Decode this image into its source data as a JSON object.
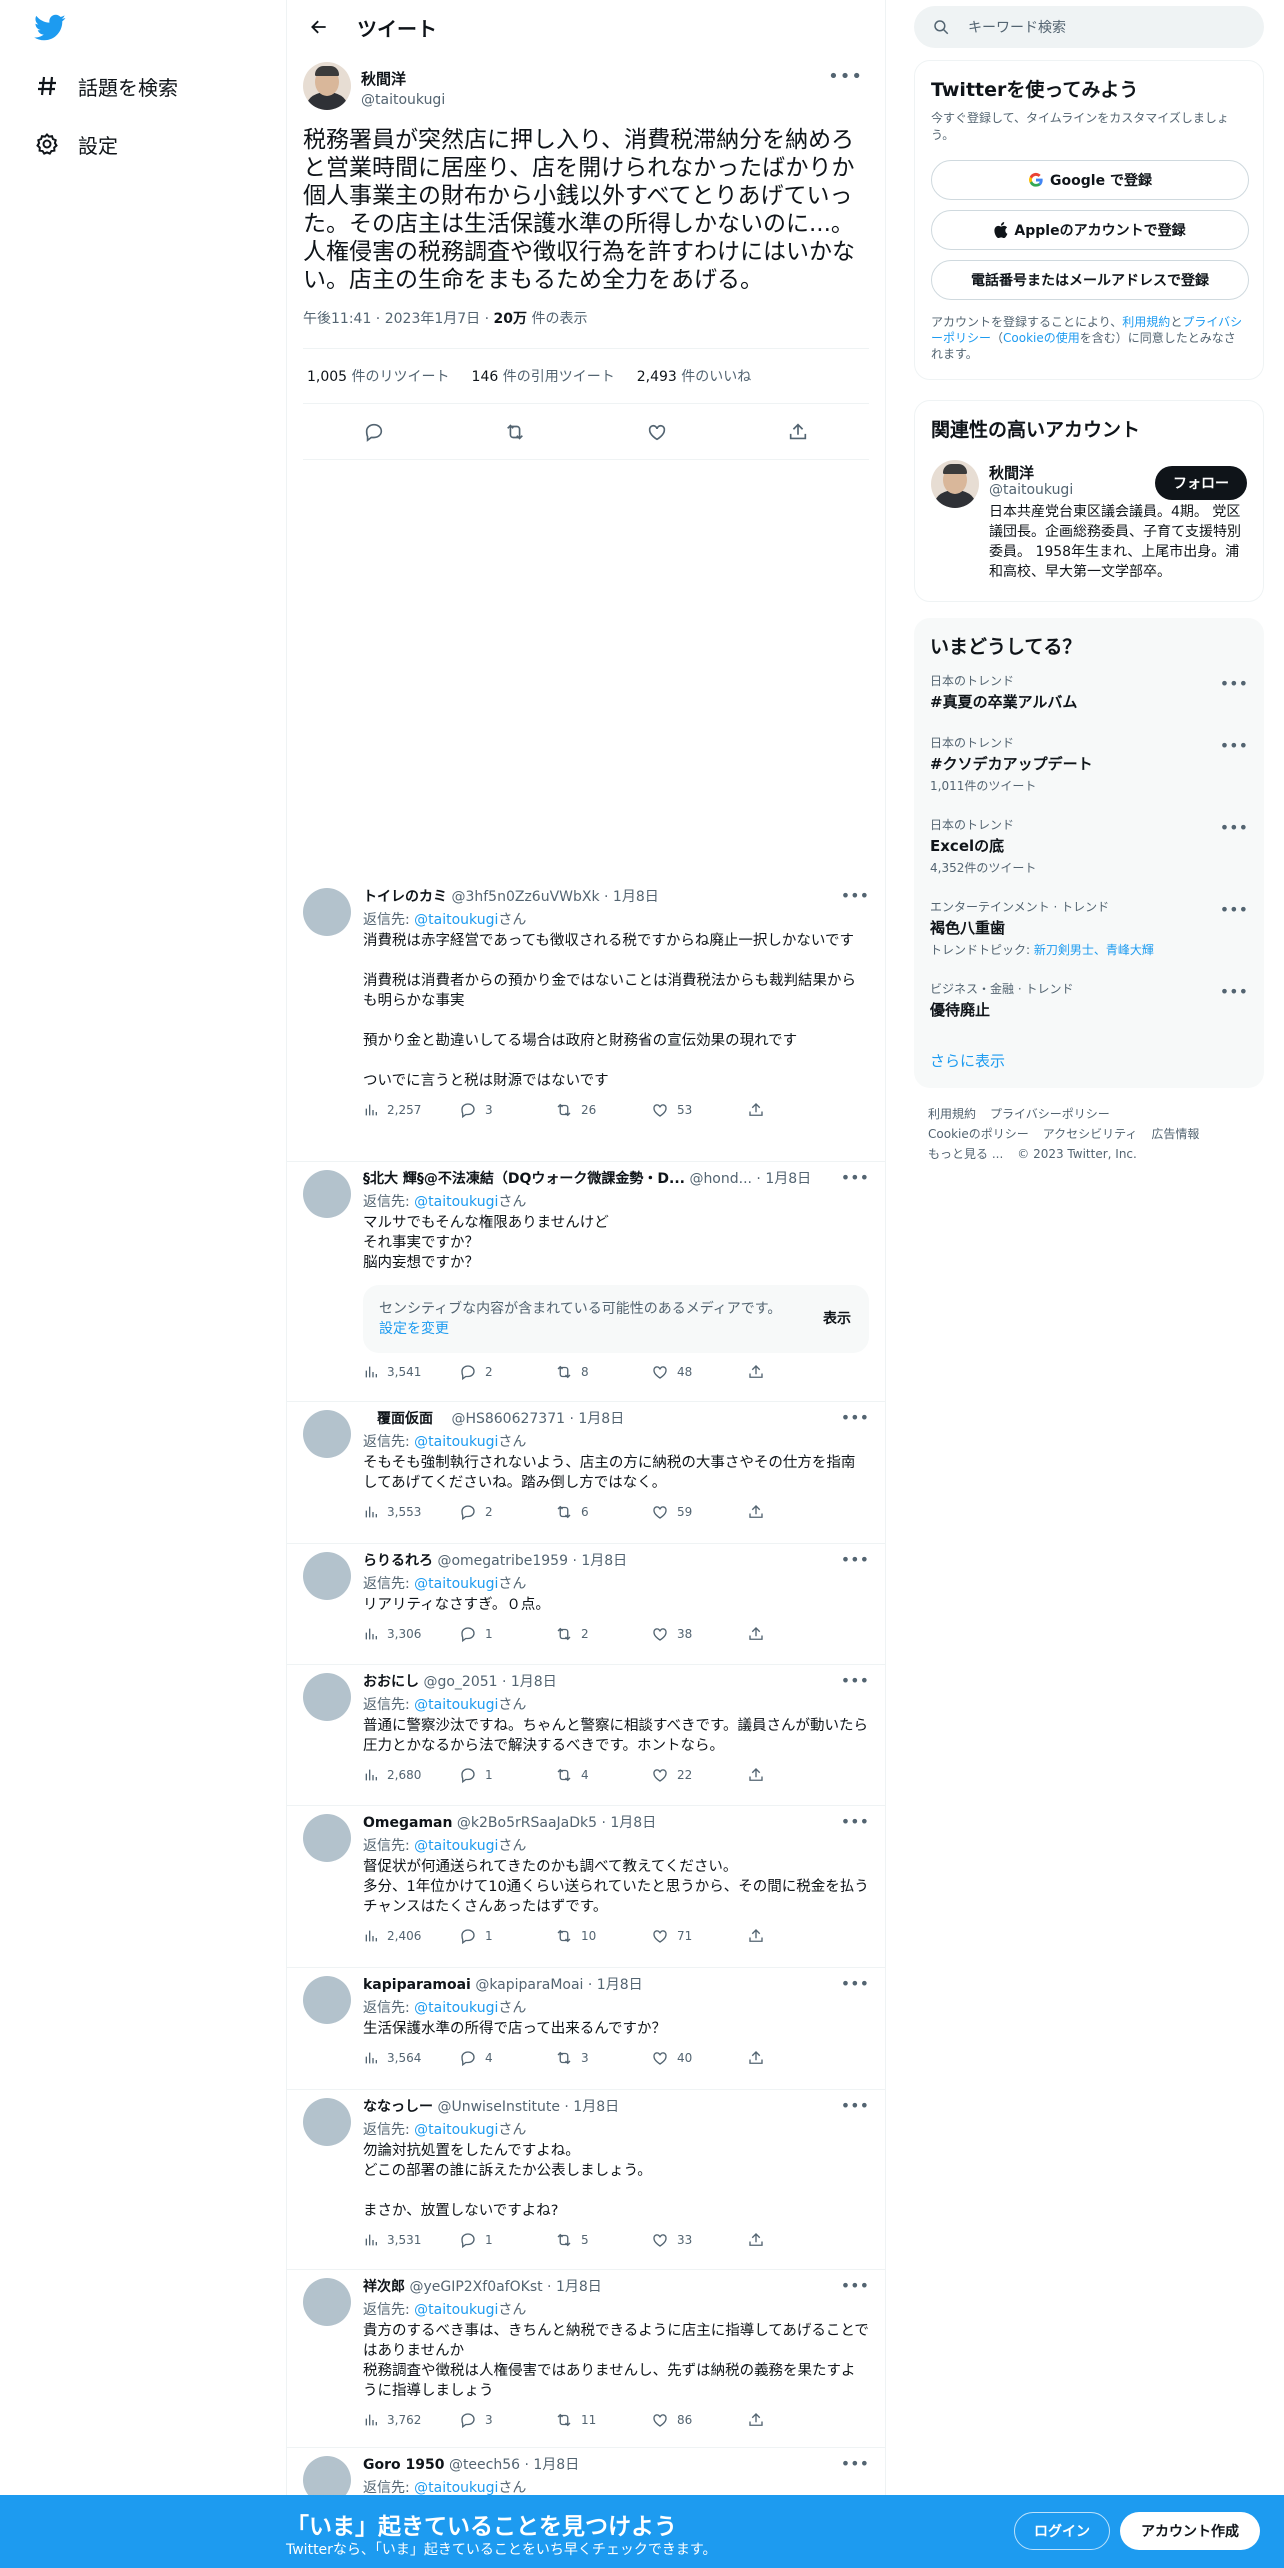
{
  "nav": {
    "explore": "話題を検索",
    "settings": "設定"
  },
  "header": {
    "title": "ツイート"
  },
  "main_tweet": {
    "name": "秋間洋",
    "handle": "@taitoukugi",
    "text": "税務署員が突然店に押し入り、消費税滞納分を納めろと営業時間に居座り、店を開けられなかったばかりか個人事業主の財布から小銭以外すべてとりあげていった。その店主は生活保護水準の所得しかないのに...。人権侵害の税務調査や徴収行為を許すわけにはいかない。店主の生命をまもるため全力をあげる。",
    "time": "午後11:41",
    "date": "2023年1月7日",
    "views": "20万",
    "views_label": "件の表示",
    "retweets": "1,005",
    "retweets_label": "件のリツイート",
    "quotes": "146",
    "quotes_label": "件の引用ツイート",
    "likes": "2,493",
    "likes_label": "件のいいね"
  },
  "reply_label": "返信先:",
  "reply_to": "@taitoukugi",
  "reply_suffix": "さん",
  "sensitive": {
    "text": "センシティブな内容が含まれている可能性のあるメディアです。",
    "link": "設定を変更",
    "show": "表示"
  },
  "replies": [
    {
      "name": "トイレのカミ",
      "meta": "@3hf5n0Zz6uVWbXk · 1月8日",
      "text": "消費税は赤字経営であっても徴収される税ですからね廃止一択しかないです\n\n消費税は消費者からの預かり金ではないことは消費税法からも裁判結果からも明らかな事実\n\n預かり金と勘違いしてる場合は政府と財務省の宣伝効果の現れです\n\nついでに言うと税は財源ではないです",
      "views": "2,257",
      "replies": "3",
      "retweets": "26",
      "likes": "53"
    },
    {
      "name": "§北大 輝§@不法凍結（DQウォーク微課金勢・D...",
      "meta": "@hond... · 1月8日",
      "text": "マルサでもそんな権限ありませんけど\nそれ事実ですか？\n脳内妄想ですか？",
      "views": "3,541",
      "replies": "2",
      "retweets": "8",
      "likes": "48"
    },
    {
      "name": "　覆面仮面　",
      "meta": "@HS860627371 · 1月8日",
      "text": "そもそも強制執行されないよう、店主の方に納税の大事さやその仕方を指南してあげてくださいね。踏み倒し方ではなく。",
      "views": "3,553",
      "replies": "2",
      "retweets": "6",
      "likes": "59"
    },
    {
      "name": "らりるれろ",
      "meta": "@omegatribe1959 · 1月8日",
      "text": "リアリティなさすぎ。０点。",
      "views": "3,306",
      "replies": "1",
      "retweets": "2",
      "likes": "38"
    },
    {
      "name": "おおにし",
      "meta": "@go_2051 · 1月8日",
      "text": "普通に警察沙汰ですね。ちゃんと警察に相談すべきです。議員さんが動いたら圧力とかなるから法で解決するべきです。ホントなら。",
      "views": "2,680",
      "replies": "1",
      "retweets": "4",
      "likes": "22"
    },
    {
      "name": "Omegaman",
      "meta": "@k2Bo5rRSaaJaDk5 · 1月8日",
      "text": "督促状が何通送られてきたのかも調べて教えてください。\n多分、1年位かけて10通くらい送られていたと思うから、その間に税金を払うチャンスはたくさんあったはずです。",
      "views": "2,406",
      "replies": "1",
      "retweets": "10",
      "likes": "71"
    },
    {
      "name": "kapiparamoai",
      "meta": "@kapiparaMoai · 1月8日",
      "text": "生活保護水準の所得で店って出来るんですか？",
      "views": "3,564",
      "replies": "4",
      "retweets": "3",
      "likes": "40"
    },
    {
      "name": "ななっしー",
      "meta": "@UnwiseInstitute · 1月8日",
      "text": "勿論対抗処置をしたんですよね。\nどこの部署の誰に訴えたか公表しましょう。\n\nまさか、放置しないですよね?",
      "views": "3,531",
      "replies": "1",
      "retweets": "5",
      "likes": "33"
    },
    {
      "name": "祥次郎",
      "meta": "@yeGIP2Xf0afOKst · 1月8日",
      "text": "貴方のするべき事は、きちんと納税できるように店主に指導してあげることではありませんか\n税務調査や徴税は人権侵害ではありませんし、先ずは納税の義務を果たすように指導しましょう",
      "views": "3,762",
      "replies": "3",
      "retweets": "11",
      "likes": "86"
    },
    {
      "name": "Goro 1950",
      "meta": "@teech56 · 1月8日"
    }
  ],
  "search": {
    "placeholder": "キーワード検索"
  },
  "signup": {
    "title": "Twitterを使ってみよう",
    "sub": "今すぐ登録して、タイムラインをカスタマイズしましょう。",
    "google": "Google で登録",
    "apple": "Appleのアカウントで登録",
    "phone": "電話番号またはメールアドレスで登録",
    "legal_a": "アカウントを登録することにより、",
    "legal_link1": "利用規約",
    "legal_b": "と",
    "legal_link2": "プライバシーポリシー",
    "legal_c": "（",
    "legal_link3": "Cookieの使用",
    "legal_d": "を含む）に同意したとみなされます。"
  },
  "related": {
    "title": "関連性の高いアカウント",
    "name": "秋間洋",
    "handle": "@taitoukugi",
    "follow": "フォロー",
    "bio": "日本共産党台東区議会議員。4期。 党区議団長。企画総務委員、子育て支援特別委員。 1958年生まれ、上尾市出身。浦和高校、早大第一文学部卒。"
  },
  "trends": {
    "title": "いまどうしてる？",
    "items": [
      {
        "cat": "日本のトレンド",
        "name": "#真夏の卒業アルバム",
        "count": ""
      },
      {
        "cat": "日本のトレンド",
        "name": "#クソデカアップデート",
        "count": "1,011件のツイート"
      },
      {
        "cat": "日本のトレンド",
        "name": "Excelの底",
        "count": "4,352件のツイート"
      },
      {
        "cat": "エンターテインメント · トレンド",
        "name": "褐色八重歯",
        "count_prefix": "トレンドトピック: ",
        "count_links": "新刀剣男士、青峰大輝"
      },
      {
        "cat": "ビジネス・金融 · トレンド",
        "name": "優待廃止",
        "count": ""
      }
    ],
    "more": "さらに表示"
  },
  "footer": {
    "l1": "利用規約",
    "l2": "プライバシーポリシー",
    "l3": "Cookieのポリシー",
    "l4": "アクセシビリティ",
    "l5": "広告情報",
    "l6": "もっと見る ...",
    "l7": "© 2023 Twitter, Inc."
  },
  "bottombar": {
    "title": "「いま」起きていることを見つけよう",
    "sub": "Twitterなら、「いま」起きていることをいち早くチェックできます。",
    "login": "ログイン",
    "signup": "アカウント作成"
  }
}
